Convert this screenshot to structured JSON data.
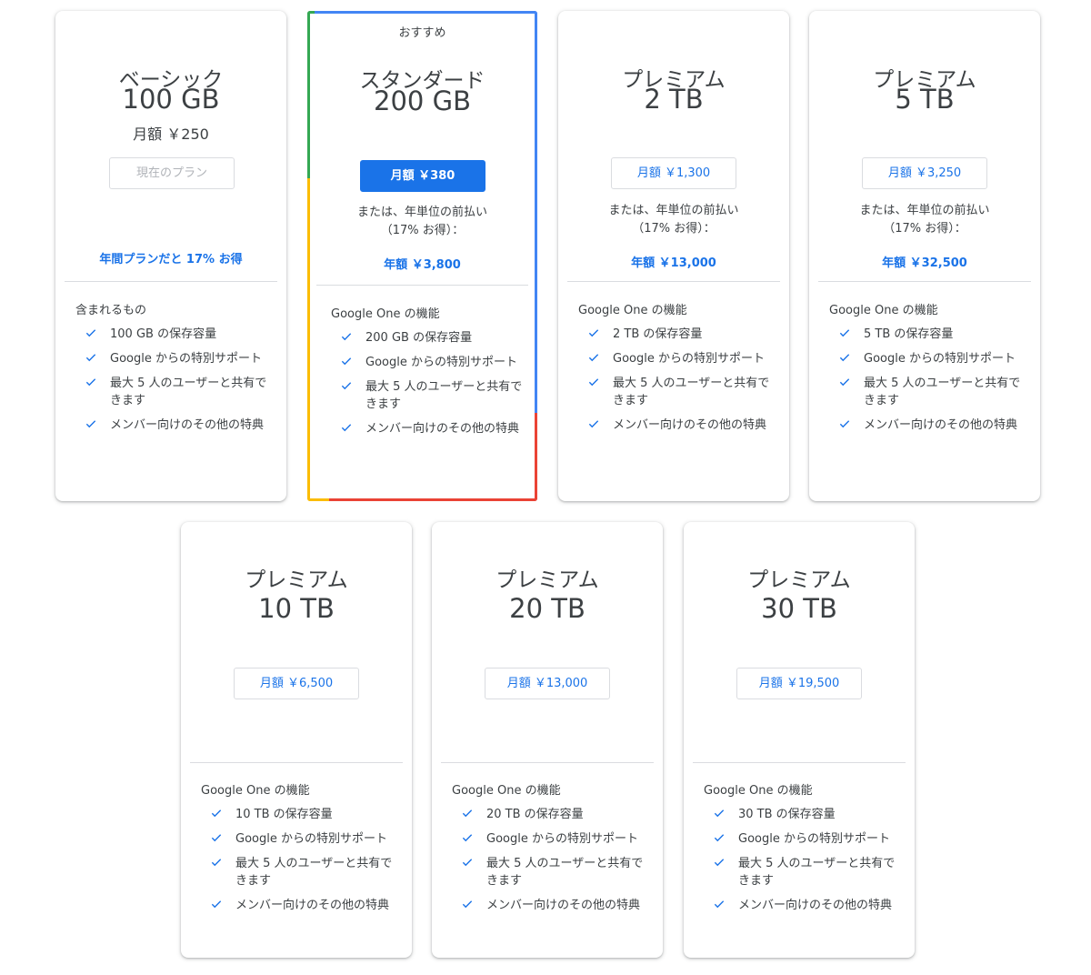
{
  "recommended_label": "おすすめ",
  "features": {
    "basic_heading": "含まれるもの",
    "one_heading": "Google One の機能",
    "support": "Google からの特別サポート",
    "share": "最大 5 人のユーザーと共有できます",
    "perks": "メンバー向けのその他の特典"
  },
  "plans": [
    {
      "tier": "ベーシック",
      "size": "100 GB",
      "price_text": "月額 ￥250",
      "button": "現在のプラン",
      "promo": "年間プランだと 17% お得",
      "storage": "100 GB の保存容量"
    },
    {
      "tier": "スタンダード",
      "size": "200 GB",
      "button": "月額 ￥380",
      "annual_note": "または、年単位の前払い（17% お得）：",
      "annual_price": "年額 ￥3,800",
      "storage": "200 GB の保存容量"
    },
    {
      "tier": "プレミアム",
      "size": "2 TB",
      "button": "月額 ￥1,300",
      "annual_note": "または、年単位の前払い（17% お得）：",
      "annual_price": "年額 ￥13,000",
      "storage": "2 TB の保存容量"
    },
    {
      "tier": "プレミアム",
      "size": "5 TB",
      "button": "月額 ￥3,250",
      "annual_note": "または、年単位の前払い（17% お得）：",
      "annual_price": "年額 ￥32,500",
      "storage": "5 TB の保存容量"
    },
    {
      "tier": "プレミアム",
      "size": "10 TB",
      "button": "月額 ￥6,500",
      "storage": "10 TB の保存容量"
    },
    {
      "tier": "プレミアム",
      "size": "20 TB",
      "button": "月額 ￥13,000",
      "storage": "20 TB の保存容量"
    },
    {
      "tier": "プレミアム",
      "size": "30 TB",
      "button": "月額 ￥19,500",
      "storage": "30 TB の保存容量"
    }
  ],
  "colors": {
    "accent_blue": "#1a73e8",
    "google_blue": "#4285f4",
    "google_red": "#ea4335",
    "google_yellow": "#fbbc04",
    "google_green": "#34a853"
  }
}
